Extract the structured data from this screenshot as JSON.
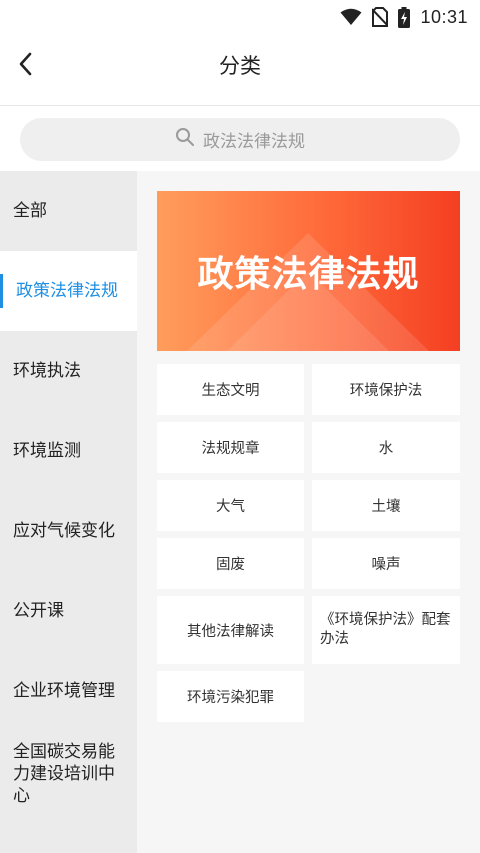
{
  "status_bar": {
    "time": "10:31",
    "icons": [
      "wifi-icon",
      "no-sim-icon",
      "battery-charging-icon"
    ]
  },
  "header": {
    "title": "分类",
    "back_icon": "chevron-left-icon"
  },
  "search": {
    "placeholder": "政法法律法规",
    "icon": "search-icon"
  },
  "sidebar": {
    "items": [
      {
        "label": "全部",
        "active": false
      },
      {
        "label": "政策法律法规",
        "active": true
      },
      {
        "label": "环境执法",
        "active": false
      },
      {
        "label": "环境监测",
        "active": false
      },
      {
        "label": "应对气候变化",
        "active": false
      },
      {
        "label": "公开课",
        "active": false
      },
      {
        "label": "企业环境管理",
        "active": false
      },
      {
        "label": "全国碳交易能力建设培训中心",
        "active": false
      }
    ]
  },
  "banner": {
    "title": "政策法律法规"
  },
  "subcategories": [
    "生态文明",
    "环境保护法",
    "法规规章",
    "水",
    "大气",
    "土壤",
    "固废",
    "噪声",
    "其他法律解读",
    "《环境保护法》配套办法",
    "环境污染犯罪"
  ],
  "colors": {
    "accent": "#1e8fe3",
    "banner_start": "#ff9d5c",
    "banner_end": "#f43f22"
  }
}
